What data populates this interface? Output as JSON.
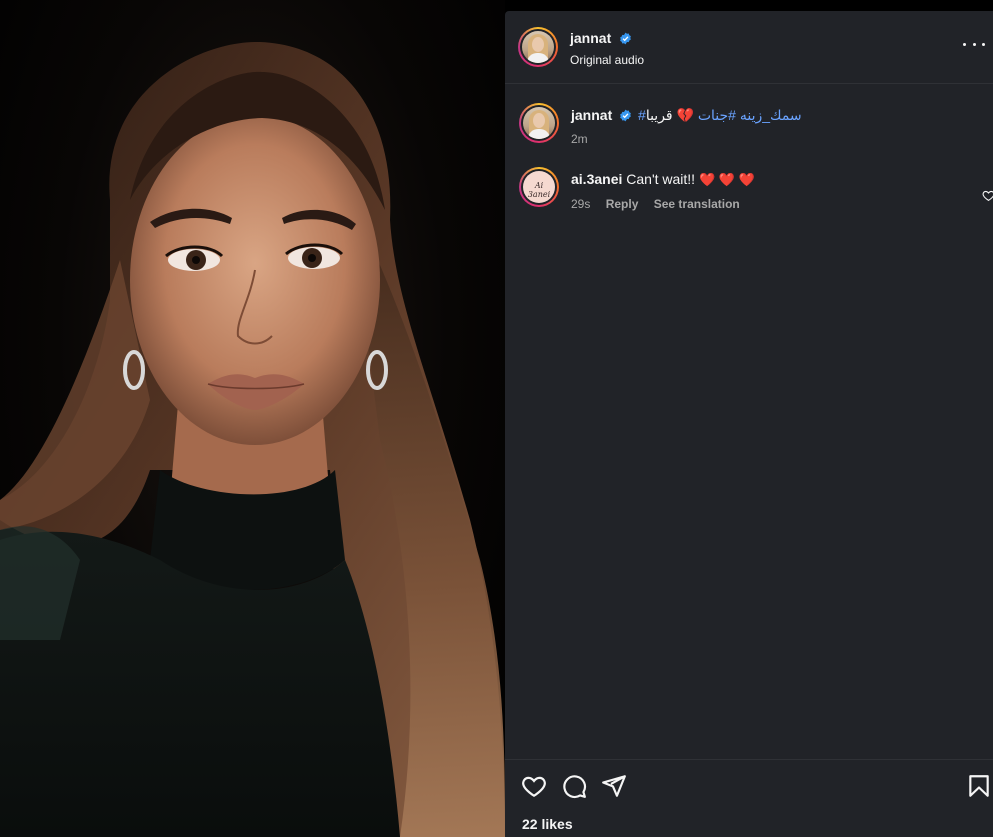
{
  "post": {
    "author": "jannat",
    "audio_label": "Original audio"
  },
  "caption": {
    "author": "jannat",
    "hashtags": "#سمك_زينه #جنات",
    "text_rtl": "قريبا",
    "heart_emoji": "💔",
    "time": "2m"
  },
  "comments": [
    {
      "author": "ai.3anei",
      "avatar_text": "Ai 3anei",
      "text": "Can't wait!!",
      "emoji": "❤️ ❤️ ❤️",
      "time": "29s",
      "reply_label": "Reply",
      "translate_label": "See translation"
    }
  ],
  "footer": {
    "likes": "22 likes"
  },
  "icons": {
    "verified": "verified-badge-icon",
    "more": "more-options-icon",
    "like": "heart-icon",
    "comment": "comment-icon",
    "share": "share-icon",
    "save": "bookmark-icon"
  },
  "colors": {
    "panel_bg": "#212328",
    "verified": "#3797f0",
    "hashtag": "#6aa3ff",
    "heart": "#ff3040"
  }
}
